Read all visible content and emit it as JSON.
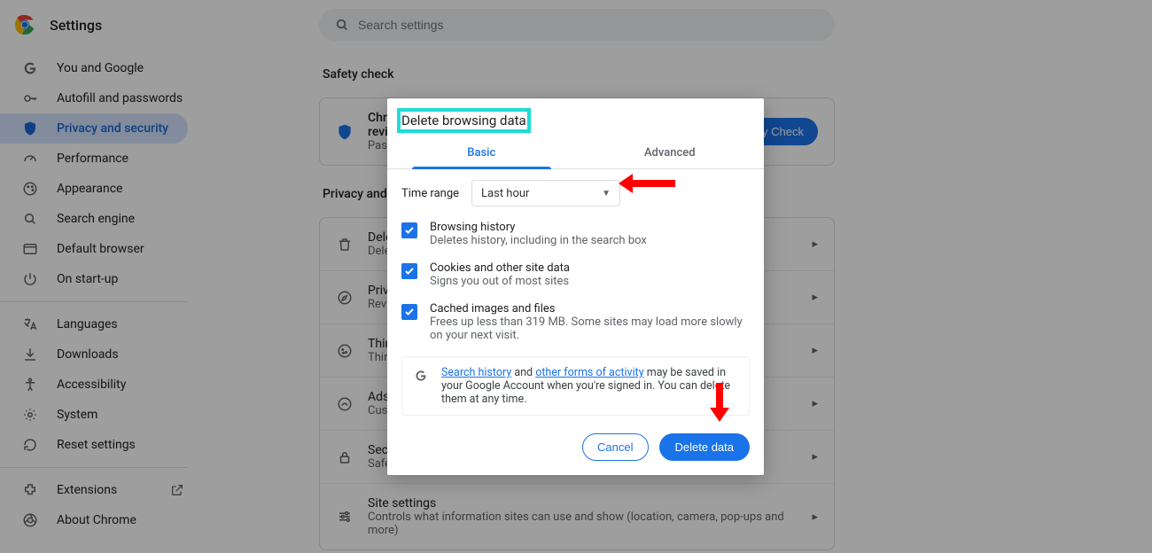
{
  "app": {
    "title": "Settings",
    "search_placeholder": "Search settings"
  },
  "sidebar": {
    "items": [
      {
        "label": "You and Google"
      },
      {
        "label": "Autofill and passwords"
      },
      {
        "label": "Privacy and security"
      },
      {
        "label": "Performance"
      },
      {
        "label": "Appearance"
      },
      {
        "label": "Search engine"
      },
      {
        "label": "Default browser"
      },
      {
        "label": "On start-up"
      }
    ],
    "items2": [
      {
        "label": "Languages"
      },
      {
        "label": "Downloads"
      },
      {
        "label": "Accessibility"
      },
      {
        "label": "System"
      },
      {
        "label": "Reset settings"
      }
    ],
    "items3": [
      {
        "label": "Extensions"
      },
      {
        "label": "About Chrome"
      }
    ]
  },
  "safetyCheck": {
    "section": "Safety check",
    "title": "Chrome found some safety recommendations for your review",
    "subtitle": "Passwords, extensions, and more",
    "button": "Safety Check"
  },
  "privacy": {
    "section": "Privacy and security",
    "rows": [
      {
        "title": "Delete browsing data",
        "sub": "Delete history, cookies, cache and more"
      },
      {
        "title": "Privacy Guide",
        "sub": "Review key privacy and security controls"
      },
      {
        "title": "Third-party cookies",
        "sub": "Third-party cookies are blocked in Incognito mode"
      },
      {
        "title": "Ads privacy",
        "sub": "Customise the info used by sites to show you ads"
      },
      {
        "title": "Security",
        "sub": "Safe Browsing (protection from dangerous sites) and other security settings"
      },
      {
        "title": "Site settings",
        "sub": "Controls what information sites can use and show (location, camera, pop-ups and more)"
      }
    ]
  },
  "modal": {
    "title": "Delete browsing data",
    "tabs": {
      "basic": "Basic",
      "advanced": "Advanced"
    },
    "timeRangeLabel": "Time range",
    "timeRangeValue": "Last hour",
    "options": [
      {
        "title": "Browsing history",
        "desc": "Deletes history, including in the search box"
      },
      {
        "title": "Cookies and other site data",
        "desc": "Signs you out of most sites"
      },
      {
        "title": "Cached images and files",
        "desc": "Frees up less than 319 MB. Some sites may load more slowly on your next visit."
      }
    ],
    "info": {
      "link1": "Search history",
      "mid": " and ",
      "link2": "other forms of activity",
      "rest": " may be saved in your Google Account when you're signed in. You can delete them at any time."
    },
    "cancel": "Cancel",
    "confirm": "Delete data"
  }
}
